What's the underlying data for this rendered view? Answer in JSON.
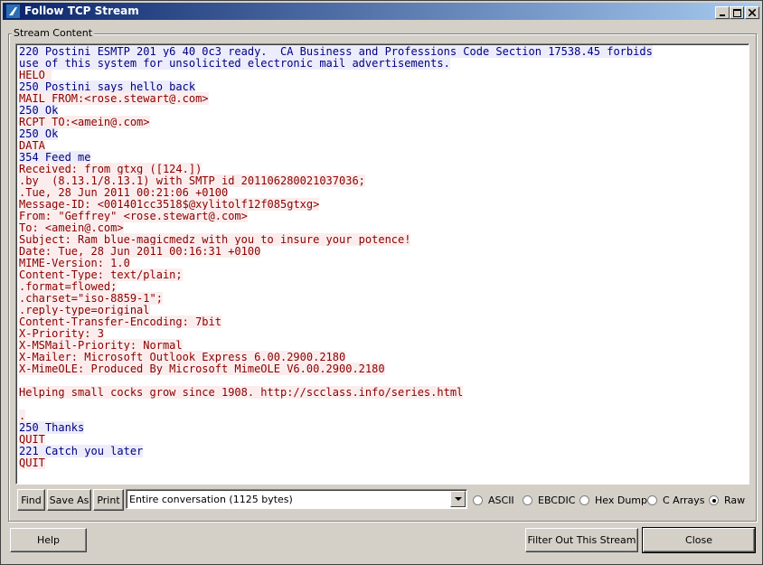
{
  "window": {
    "title": "Follow TCP Stream"
  },
  "group": {
    "label": "Stream Content"
  },
  "stream": [
    [
      {
        "t": "220 Postini ESMTP 201 y6_40_0c3 ready.  CA Business and Professions Code Section 17538.45 forbids",
        "c": "server"
      }
    ],
    [
      {
        "t": "use of this system for unsolicited electronic mail advertisements.",
        "c": "server"
      }
    ],
    [
      {
        "t": "HELO ",
        "c": "client"
      },
      {
        "r": 290
      }
    ],
    [
      {
        "t": "250 Postini says hello back",
        "c": "server"
      }
    ],
    [
      {
        "t": "MAIL FROM:<rose.stewart@",
        "c": "client"
      },
      {
        "r": 72
      },
      {
        "t": ".com>",
        "c": "client"
      }
    ],
    [
      {
        "t": "250 Ok",
        "c": "server"
      }
    ],
    [
      {
        "t": "RCPT TO:<amein@",
        "c": "client"
      },
      {
        "r": 144
      },
      {
        "t": ".com>",
        "c": "client"
      }
    ],
    [
      {
        "t": "250 Ok",
        "c": "server"
      }
    ],
    [
      {
        "t": "DATA",
        "c": "client"
      }
    ],
    [
      {
        "t": "354 Feed me",
        "c": "server"
      }
    ],
    [
      {
        "t": "Received: from gtxg ([124.",
        "c": "client"
      },
      {
        "r": 76
      },
      {
        "t": "])",
        "c": "client"
      }
    ],
    [
      {
        "t": ".by  (8.13.1/8.13.1) with SMTP id 201106280021037036;",
        "c": "client"
      }
    ],
    [
      {
        "t": ".Tue, 28 Jun 2011 00:21:06 +0100",
        "c": "client"
      }
    ],
    [
      {
        "t": "Message-ID: <001401cc3518$",
        "c": "client"
      },
      {
        "r": 137
      },
      {
        "t": "@xylitolf12f085gtxg>",
        "c": "client"
      }
    ],
    [
      {
        "t": "From: \"Geffrey\" <rose.stewart@",
        "c": "client"
      },
      {
        "r": 70
      },
      {
        "t": ".com>",
        "c": "client"
      }
    ],
    [
      {
        "t": "To: <amein@",
        "c": "client"
      },
      {
        "r": 136
      },
      {
        "t": ".com>",
        "c": "client"
      }
    ],
    [
      {
        "t": "Subject: Ram blue-magicmedz with you to insure your potence!",
        "c": "client"
      }
    ],
    [
      {
        "t": "Date: Tue, 28 Jun 2011 00:16:31 +0100",
        "c": "client"
      }
    ],
    [
      {
        "t": "MIME-Version: 1.0",
        "c": "client"
      }
    ],
    [
      {
        "t": "Content-Type: text/plain;",
        "c": "client"
      }
    ],
    [
      {
        "t": ".format=flowed;",
        "c": "client"
      }
    ],
    [
      {
        "t": ".charset=\"iso-8859-1\";",
        "c": "client"
      }
    ],
    [
      {
        "t": ".reply-type=original",
        "c": "client"
      }
    ],
    [
      {
        "t": "Content-Transfer-Encoding: 7bit",
        "c": "client"
      }
    ],
    [
      {
        "t": "X-Priority: 3",
        "c": "client"
      }
    ],
    [
      {
        "t": "X-MSMail-Priority: Normal",
        "c": "client"
      }
    ],
    [
      {
        "t": "X-Mailer: Microsoft Outlook Express 6.00.2900.2180",
        "c": "client"
      }
    ],
    [
      {
        "t": "X-MimeOLE: Produced By Microsoft MimeOLE V6.00.2900.2180",
        "c": "client"
      }
    ],
    [
      {
        "t": "",
        "c": "client"
      }
    ],
    [
      {
        "t": "Helping small cocks grow since 1908. http://scclass.info/series.html",
        "c": "client"
      }
    ],
    [
      {
        "t": "",
        "c": "client"
      }
    ],
    [
      {
        "t": ".",
        "c": "client"
      }
    ],
    [
      {
        "t": "250 Thanks",
        "c": "server"
      }
    ],
    [
      {
        "t": "QUIT",
        "c": "client"
      }
    ],
    [
      {
        "t": "221 Catch you later",
        "c": "server"
      }
    ],
    [
      {
        "t": "QUIT",
        "c": "client"
      }
    ]
  ],
  "toolbar": {
    "find": "Find",
    "save_as": "Save As",
    "print": "Print",
    "conversation": "Entire conversation (1125 bytes)"
  },
  "formats": {
    "options": [
      "ASCII",
      "EBCDIC",
      "Hex Dump",
      "C Arrays",
      "Raw"
    ],
    "selected": "Raw"
  },
  "footer": {
    "help": "Help",
    "filter": "Filter Out This Stream",
    "close": "Close"
  },
  "colors": {
    "client_text": "#8b0000",
    "client_bg": "#fbeded",
    "server_text": "#000080",
    "server_bg": "#ececfb",
    "redaction": "#f4c6cb"
  }
}
